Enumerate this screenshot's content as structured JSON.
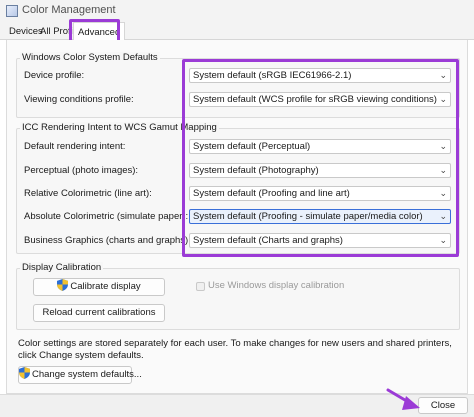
{
  "window": {
    "title": "Color Management"
  },
  "tabs": [
    {
      "label": "Devices"
    },
    {
      "label": "All Profiles"
    },
    {
      "label": "Advanced"
    }
  ],
  "wcs_group": {
    "title": "Windows Color System Defaults",
    "rows": [
      {
        "label": "Device profile:",
        "value": "System default (sRGB IEC61966-2.1)"
      },
      {
        "label": "Viewing conditions profile:",
        "value": "System default (WCS profile for sRGB viewing conditions)"
      }
    ]
  },
  "icc_group": {
    "title": "ICC Rendering Intent to WCS Gamut Mapping",
    "rows": [
      {
        "label": "Default rendering intent:",
        "value": "System default (Perceptual)"
      },
      {
        "label": "Perceptual (photo images):",
        "value": "System default (Photography)"
      },
      {
        "label": "Relative Colorimetric (line art):",
        "value": "System default (Proofing and line art)"
      },
      {
        "label": "Absolute Colorimetric (simulate paper):",
        "value": "System default (Proofing - simulate paper/media color)"
      },
      {
        "label": "Business Graphics (charts and graphs):",
        "value": "System default (Charts and graphs)"
      }
    ]
  },
  "calibration": {
    "title": "Display Calibration",
    "calibrate_label": "Calibrate display",
    "use_windows_label": "Use Windows display calibration",
    "reload_label": "Reload current calibrations"
  },
  "info_text": "Color settings are stored separately for each user. To make changes for new users and shared printers, click Change system defaults.",
  "change_defaults_label": "Change system defaults...",
  "close_label": "Close",
  "colors": {
    "highlight": "#9b3bd6",
    "focus": "#3a6fd8"
  },
  "icons": {
    "dropdown": "chevron-down-icon",
    "uac": "uac-shield-icon"
  }
}
